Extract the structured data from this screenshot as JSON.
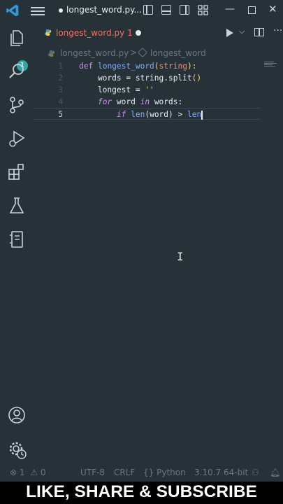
{
  "colors": {
    "background": "#263238",
    "accent": "#2ea8a0",
    "tab_modified": "#f47067",
    "keyword": "#c792ea",
    "function": "#82aaff",
    "param": "#f78c6c",
    "string": "#c3e88d"
  },
  "window": {
    "title": "longest_word.py..."
  },
  "icons": {
    "app": "vscode-logo-icon",
    "menu": "hamburger-menu-icon",
    "layout": [
      "sidebar-toggle-icon",
      "panel-toggle-icon",
      "secondary-sidebar-icon",
      "layout-grid-icon"
    ],
    "activity": [
      "explorer-icon",
      "search-icon",
      "source-control-icon",
      "run-debug-icon",
      "extensions-icon",
      "testing-icon",
      "notebook-icon",
      "account-icon",
      "settings-gear-icon"
    ],
    "tab_file": "python-icon",
    "breadcrumb_symbol": "symbol-method-icon"
  },
  "activity": {
    "explorer_badge": "1"
  },
  "tab": {
    "label": "longest_word.py 1"
  },
  "breadcrumb": {
    "file": "longest_word.py",
    "separator": ">",
    "symbol": "longest_word"
  },
  "editor": {
    "lines": [
      {
        "num": "1",
        "t1": "def",
        "t2": " ",
        "t3": "longest_word",
        "t4": "(",
        "t5": "string",
        "t6": "):"
      },
      {
        "num": "2",
        "t1": "    words = string.split",
        "t2": "()"
      },
      {
        "num": "3",
        "t1": "    longest = ",
        "t2": "''"
      },
      {
        "num": "4",
        "t1": "    ",
        "t2": "for",
        "t3": " word ",
        "t4": "in",
        "t5": " words:"
      },
      {
        "num": "5",
        "t1": "        ",
        "t2": "if",
        "t3": " ",
        "t4": "len",
        "t5": "(word) > ",
        "t6": "len"
      }
    ]
  },
  "status": {
    "errors": "1",
    "warnings": "0",
    "encoding": "UTF-8",
    "eol": "CRLF",
    "language": "Python",
    "interpreter": "3.10.7 64-bit"
  },
  "banner": {
    "text": "LIKE, SHARE & SUBSCRIBE"
  }
}
